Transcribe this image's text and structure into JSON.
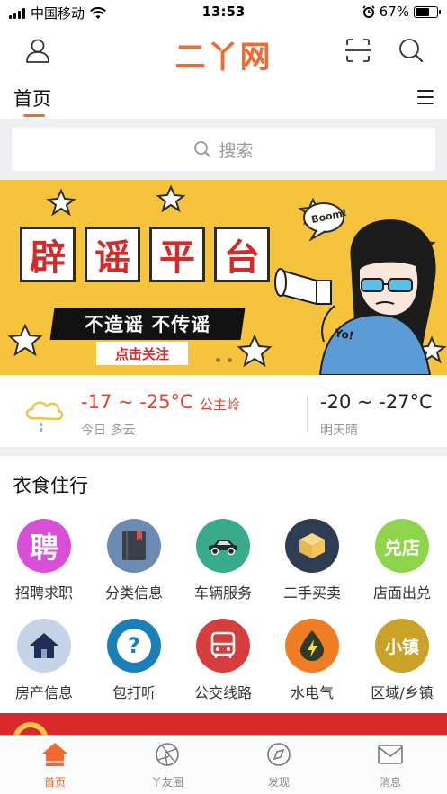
{
  "status_bar": {
    "carrier": "中国移动",
    "time": "13:53",
    "battery": "67%",
    "battery_level": 0.67
  },
  "header": {
    "logo_text": "二丫网"
  },
  "nav": {
    "home_tab": "首页"
  },
  "search": {
    "placeholder": "搜索"
  },
  "banner": {
    "title_chars": [
      "辟",
      "谣",
      "平",
      "台"
    ],
    "slogan": "不造谣 不传谣",
    "cta": "点击关注",
    "bubble_text": "Boom!",
    "shirt_text": "Yo!"
  },
  "weather": {
    "today_temp": "-17 ~ -25°C",
    "location": "公主岭",
    "today_desc": "今日 多云",
    "tomorrow_temp": "-20 ~ -27°C",
    "tomorrow_desc": "明天晴"
  },
  "section": {
    "title": "衣食住行",
    "items": [
      {
        "label": "招聘求职",
        "icon": "recruit-icon",
        "glyph": "聘",
        "color": "#d94fd7"
      },
      {
        "label": "分类信息",
        "icon": "book-icon",
        "glyph": "",
        "color": "#6b8bb3"
      },
      {
        "label": "车辆服务",
        "icon": "car-icon",
        "glyph": "",
        "color": "#38ab8c"
      },
      {
        "label": "二手买卖",
        "icon": "box-icon",
        "glyph": "",
        "color": "#2f3d52"
      },
      {
        "label": "店面出兑",
        "icon": "store-icon",
        "glyph": "兑店",
        "color": "#8fd44d"
      },
      {
        "label": "房产信息",
        "icon": "house-icon",
        "glyph": "",
        "color": "#c7d3e6"
      },
      {
        "label": "包打听",
        "icon": "question-icon",
        "glyph": "?",
        "color": "#1b7fb8"
      },
      {
        "label": "公交线路",
        "icon": "bus-icon",
        "glyph": "",
        "color": "#d63d3d"
      },
      {
        "label": "水电气",
        "icon": "utility-icon",
        "glyph": "",
        "color": "#ef7d24"
      },
      {
        "label": "区域/乡镇",
        "icon": "town-icon",
        "glyph": "小镇",
        "color": "#c9a227"
      }
    ]
  },
  "tabbar": {
    "tabs": [
      {
        "label": "首页",
        "icon": "home-icon",
        "active": true
      },
      {
        "label": "丫友圈",
        "icon": "aperture-icon",
        "active": false
      },
      {
        "label": "发现",
        "icon": "compass-icon",
        "active": false
      },
      {
        "label": "消息",
        "icon": "mail-icon",
        "active": false
      }
    ]
  },
  "colors": {
    "brand": "#f26a2e",
    "banner_bg": "#f6c43c",
    "weather_today": "#e2452f"
  }
}
